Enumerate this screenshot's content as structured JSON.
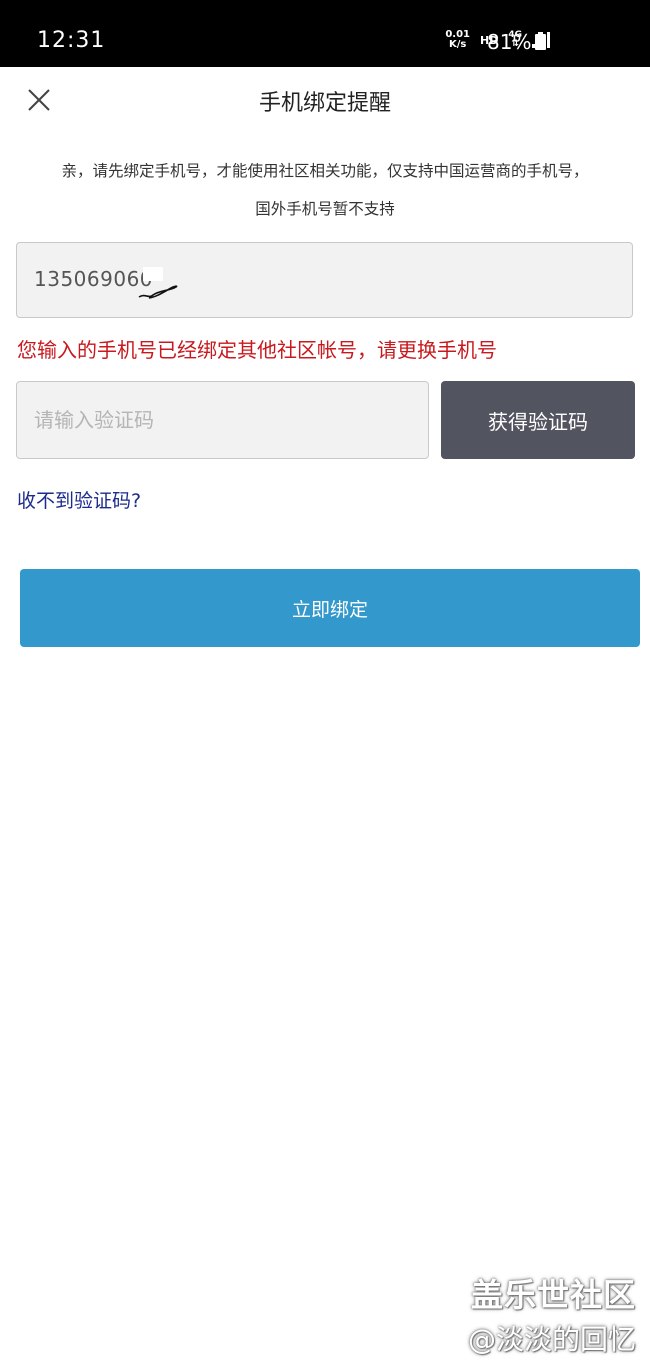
{
  "status_bar": {
    "time": "12:31",
    "net_speed_value": "0.01",
    "net_speed_unit": "K/s",
    "hd": "HD",
    "network": "4G",
    "battery": "81%"
  },
  "header": {
    "title": "手机绑定提醒",
    "close_icon": "close-icon"
  },
  "notice": {
    "line1": "亲，请先绑定手机号，才能使用社区相关功能，仅支持中国运营商的手机号，",
    "line2": "国外手机号暂不支持"
  },
  "phone_input": {
    "value": "135069060"
  },
  "error": {
    "message": "您输入的手机号已经绑定其他社区帐号，请更换手机号",
    "color": "#c8191e"
  },
  "code_input": {
    "placeholder": "请输入验证码"
  },
  "get_code_button": {
    "label": "获得验证码",
    "color": "#525560"
  },
  "no_code_link": {
    "label": "收不到验证码?",
    "color": "#1c2b8c"
  },
  "bind_button": {
    "label": "立即绑定",
    "color": "#3399cc"
  },
  "watermark": {
    "line1": "盖乐世社区",
    "line2": "@淡淡的回忆"
  }
}
